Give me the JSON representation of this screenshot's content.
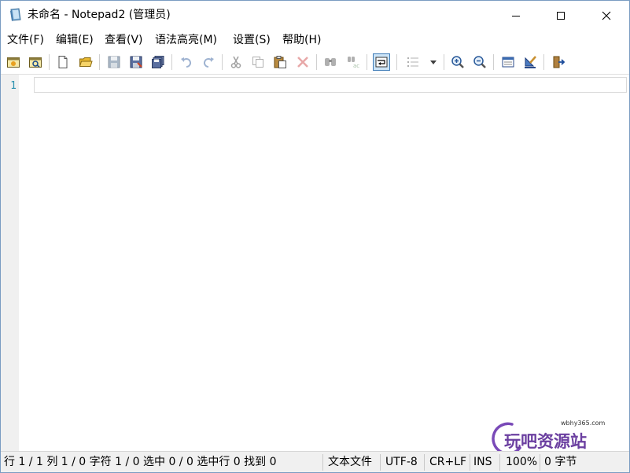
{
  "window": {
    "title": "未命名 - Notepad2 (管理员)"
  },
  "menu": [
    {
      "label": "文件(F)"
    },
    {
      "label": "编辑(E)"
    },
    {
      "label": "查看(V)"
    },
    {
      "label": "语法高亮(M)"
    },
    {
      "label": "设置(S)"
    },
    {
      "label": "帮助(H)"
    }
  ],
  "toolbar": {
    "buttons": [
      {
        "icon": "new-window-icon"
      },
      {
        "icon": "browse-icon"
      },
      {
        "icon": "new-file-icon"
      },
      {
        "icon": "open-folder-icon"
      },
      {
        "icon": "save-icon"
      },
      {
        "icon": "save-as-icon"
      },
      {
        "icon": "save-copy-icon"
      },
      {
        "icon": "undo-icon"
      },
      {
        "icon": "redo-icon"
      },
      {
        "icon": "cut-icon"
      },
      {
        "icon": "copy-icon"
      },
      {
        "icon": "paste-icon"
      },
      {
        "icon": "delete-icon"
      },
      {
        "icon": "find-icon"
      },
      {
        "icon": "replace-icon"
      },
      {
        "icon": "word-wrap-icon"
      },
      {
        "icon": "list-icon"
      },
      {
        "icon": "dropdown-arrow-icon"
      },
      {
        "icon": "zoom-in-icon"
      },
      {
        "icon": "zoom-out-icon"
      },
      {
        "icon": "scheme-icon"
      },
      {
        "icon": "customize-icon"
      },
      {
        "icon": "exit-icon"
      }
    ]
  },
  "editor": {
    "line_numbers": [
      "1"
    ]
  },
  "watermark": {
    "url": "wbhy365.com",
    "text": "玩吧资源站"
  },
  "statusbar": {
    "position": "行 1 / 1  列 1 / 0  字符 1 / 0  选中 0 / 0  选中行 0  找到 0",
    "file_type": "文本文件",
    "encoding": "UTF-8",
    "line_ending": "CR+LF",
    "insert_mode": "INS",
    "zoom": "100%",
    "size": "0 字节"
  },
  "colors": {
    "line_number": "#2b91af",
    "gutter": "#f0f0f0",
    "statusbar": "#f0f0f0",
    "active_toolbar": "#cce4f7",
    "watermark": "#6b3fa0"
  }
}
